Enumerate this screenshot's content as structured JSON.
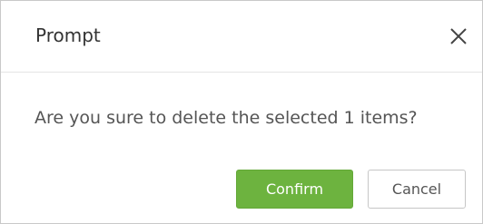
{
  "dialog": {
    "title": "Prompt",
    "close_icon": "close-icon",
    "message": "Are you sure to delete the selected 1 items?",
    "confirm_label": "Confirm",
    "cancel_label": "Cancel"
  },
  "colors": {
    "confirm_bg": "#6db33f",
    "border": "#c9c9c9",
    "text": "#555555"
  }
}
